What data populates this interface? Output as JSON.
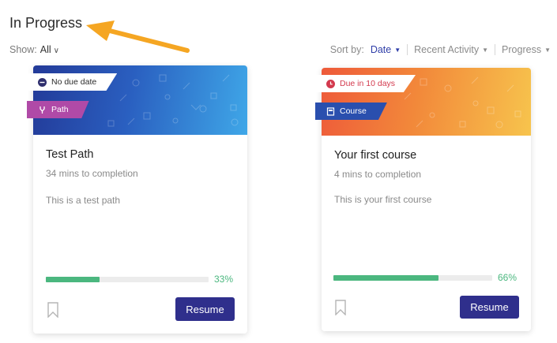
{
  "section": {
    "title": "In Progress"
  },
  "filters": {
    "show_label": "Show:",
    "show_value": "All"
  },
  "sort": {
    "label": "Sort by:",
    "options": [
      {
        "label": "Date",
        "active": true
      },
      {
        "label": "Recent Activity",
        "active": false
      },
      {
        "label": "Progress",
        "active": false
      }
    ]
  },
  "cards": [
    {
      "due_label": "No due date",
      "type_label": "Path",
      "title": "Test Path",
      "completion": "34 mins to completion",
      "description": "This is a test path",
      "progress_pct": 33,
      "progress_label": "33%",
      "button_label": "Resume"
    },
    {
      "due_label": "Due in 10 days",
      "type_label": "Course",
      "title": "Your first course",
      "completion": "4 mins to completion",
      "description": "This is your first course",
      "progress_pct": 66,
      "progress_label": "66%",
      "button_label": "Resume"
    }
  ],
  "colors": {
    "accent": "#2f3ea8",
    "progress": "#4bb77f",
    "resume_button": "#2f2f8c",
    "due_red": "#d33a4e",
    "path_tag": "#b04aa7",
    "course_tag": "#2a4fae"
  }
}
